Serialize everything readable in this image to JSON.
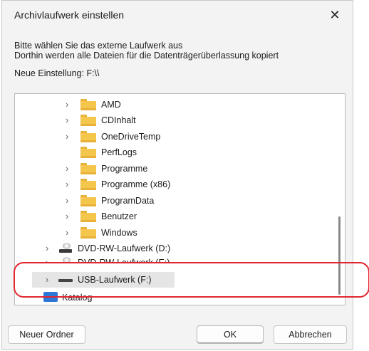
{
  "dialog": {
    "title": "Archivlaufwerk einstellen",
    "close_label": "✕",
    "message_line1": "Bitte wählen Sie das externe Laufwerk aus",
    "message_line2": "Dorthin werden alle Dateien für die Datenträgerüberlassung kopiert",
    "current_setting": "Neue Einstellung: F:\\\\"
  },
  "tree": {
    "folders": [
      {
        "label": "AMD",
        "expandable": true
      },
      {
        "label": "CDInhalt",
        "expandable": true
      },
      {
        "label": "OneDriveTemp",
        "expandable": true
      },
      {
        "label": "PerfLogs",
        "expandable": false
      },
      {
        "label": "Programme",
        "expandable": true
      },
      {
        "label": "Programme (x86)",
        "expandable": true
      },
      {
        "label": "ProgramData",
        "expandable": true
      },
      {
        "label": "Benutzer",
        "expandable": true
      },
      {
        "label": "Windows",
        "expandable": true
      }
    ],
    "drives": [
      {
        "label": "DVD-RW-Laufwerk (D:)"
      },
      {
        "label": "DVD-RW-Laufwerk (E:)"
      },
      {
        "label": "USB-Laufwerk (F:)",
        "selected": true
      }
    ],
    "catalog_label": "Katalog"
  },
  "buttons": {
    "new_folder": "Neuer Ordner",
    "ok": "OK",
    "cancel": "Abbrechen"
  },
  "colors": {
    "highlight": "#e2262f",
    "folder": "#f5c64c",
    "selection": "#e5e5e5"
  }
}
